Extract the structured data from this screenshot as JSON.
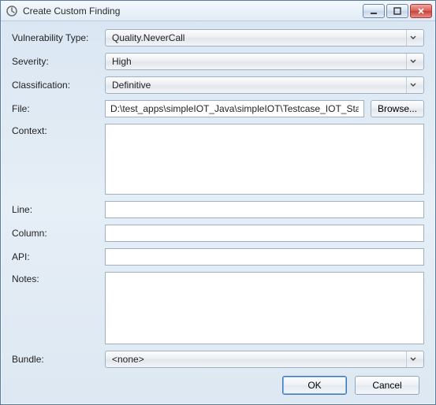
{
  "window": {
    "title": "Create Custom Finding"
  },
  "labels": {
    "vulnerability_type": "Vulnerability Type:",
    "severity": "Severity:",
    "classification": "Classification:",
    "file": "File:",
    "context": "Context:",
    "line": "Line:",
    "column": "Column:",
    "api": "API:",
    "notes": "Notes:",
    "bundle": "Bundle:"
  },
  "values": {
    "vulnerability_type": "Quality.NeverCall",
    "severity": "High",
    "classification": "Definitive",
    "file": "D:\\test_apps\\simpleIOT_Java\\simpleIOT\\Testcase_IOT_Static.ja",
    "context": "",
    "line": "",
    "column": "",
    "api": "",
    "notes": "",
    "bundle": "<none>"
  },
  "buttons": {
    "browse": "Browse...",
    "ok": "OK",
    "cancel": "Cancel"
  }
}
